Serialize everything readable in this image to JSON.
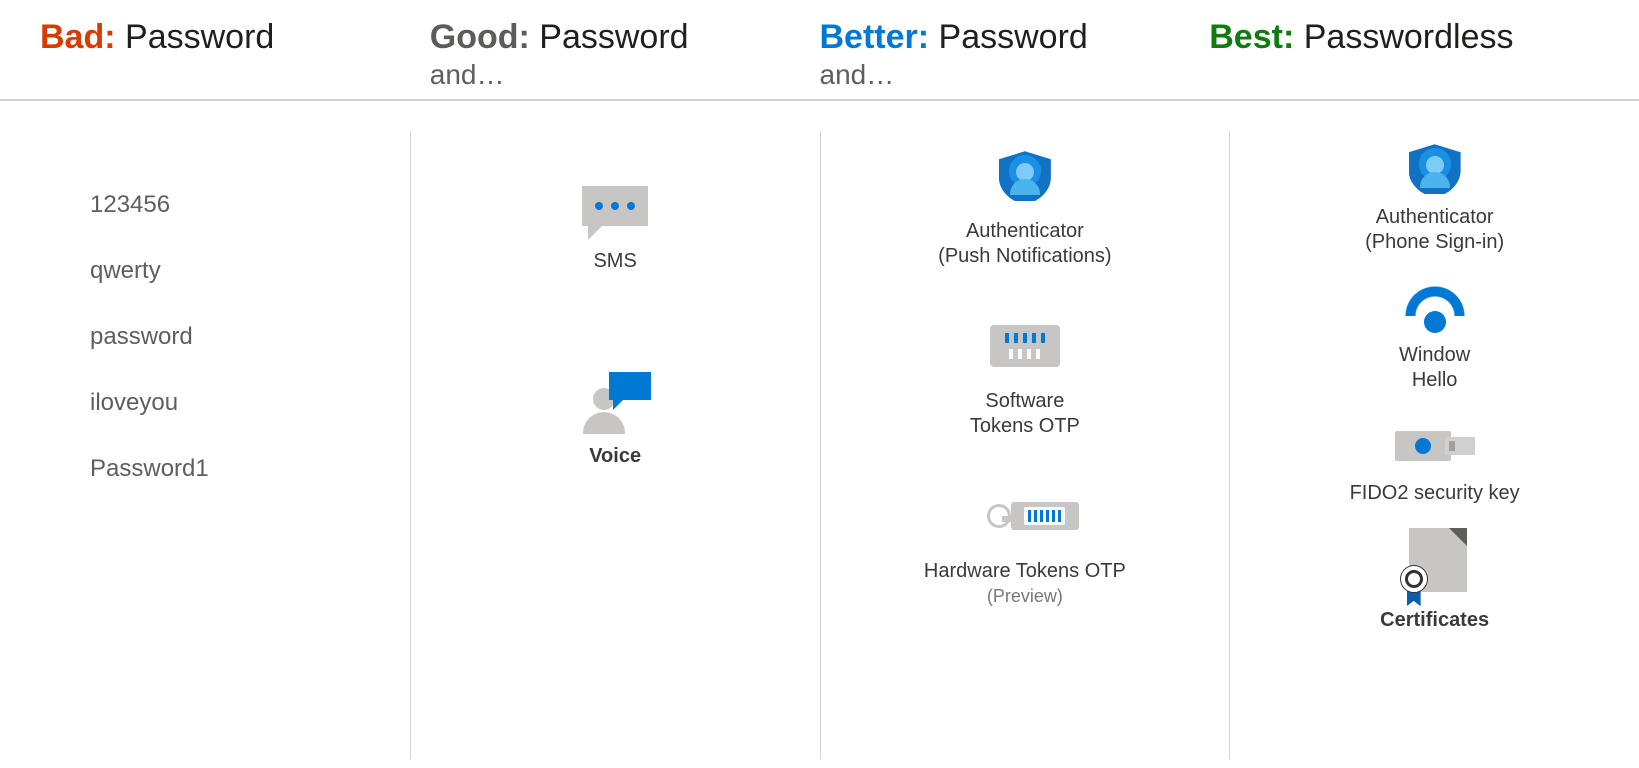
{
  "colors": {
    "bad": "#d83b01",
    "good": "#5d5c5b",
    "better": "#0078d4",
    "best": "#107c10"
  },
  "columns": {
    "bad": {
      "prefix": "Bad:",
      "title": "Password",
      "subtitle": "",
      "passwords": [
        "123456",
        "qwerty",
        "password",
        "iloveyou",
        "Password1"
      ]
    },
    "good": {
      "prefix": "Good:",
      "title": "Password",
      "subtitle": "and…",
      "items": [
        {
          "icon": "sms-icon",
          "label": "SMS"
        },
        {
          "icon": "voice-icon",
          "label": "Voice"
        }
      ]
    },
    "better": {
      "prefix": "Better:",
      "title": "Password",
      "subtitle": "and…",
      "items": [
        {
          "icon": "authenticator-icon",
          "label_line1": "Authenticator",
          "label_line2": "(Push Notifications)"
        },
        {
          "icon": "software-token-icon",
          "label_line1": "Software",
          "label_line2": "Tokens OTP"
        },
        {
          "icon": "hardware-token-icon",
          "label_line1": "Hardware Tokens OTP",
          "label_sub": "(Preview)"
        }
      ]
    },
    "best": {
      "prefix": "Best:",
      "title": "Passwordless",
      "subtitle": "",
      "items": [
        {
          "icon": "authenticator-icon",
          "label_line1": "Authenticator",
          "label_line2": "(Phone Sign-in)"
        },
        {
          "icon": "windows-hello-icon",
          "label_line1": "Window",
          "label_line2": "Hello"
        },
        {
          "icon": "fido2-key-icon",
          "label_line1": "FIDO2 security key"
        },
        {
          "icon": "certificate-icon",
          "label_line1": "Certificates",
          "bold": true
        }
      ]
    }
  }
}
